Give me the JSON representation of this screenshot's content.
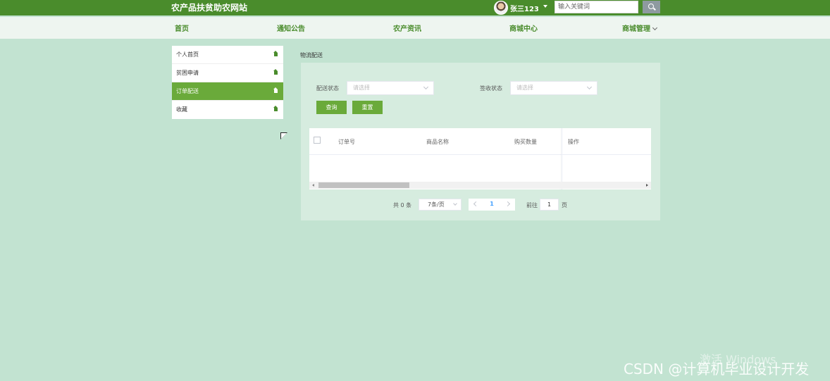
{
  "header": {
    "site_title": "农产品扶贫助农网站",
    "username": "张三123",
    "search_placeholder": "输入关键词"
  },
  "nav": {
    "items": [
      "首页",
      "通知公告",
      "农产资讯",
      "商城中心",
      "商城管理"
    ]
  },
  "sidebar": {
    "items": [
      {
        "label": "个人首页",
        "active": false
      },
      {
        "label": "贫困申请",
        "active": false
      },
      {
        "label": "订单配送",
        "active": true
      },
      {
        "label": "收藏",
        "active": false
      }
    ]
  },
  "main": {
    "breadcrumb": "物流配送",
    "filters": {
      "delivery_status_label": "配送状态",
      "delivery_status_placeholder": "请选择",
      "receipt_status_label": "签收状态",
      "receipt_status_placeholder": "请选择"
    },
    "buttons": {
      "query": "查询",
      "reset": "重置"
    },
    "table": {
      "columns": [
        "订单号",
        "商品名称",
        "购买数量",
        "操作"
      ],
      "rows": []
    },
    "pagination": {
      "total_text": "共 0 条",
      "page_size": "7条/页",
      "current_page": "1",
      "goto_label": "前往",
      "goto_value": "1",
      "page_suffix": "页"
    }
  },
  "watermarks": {
    "windows": "激活 Windows",
    "csdn": "CSDN @计算机毕业设计开发"
  },
  "colors": {
    "primary_green": "#4a8c2c",
    "accent_green": "#6aaa3a",
    "page_background": "#c2e3d1",
    "link_blue": "#409eff"
  }
}
